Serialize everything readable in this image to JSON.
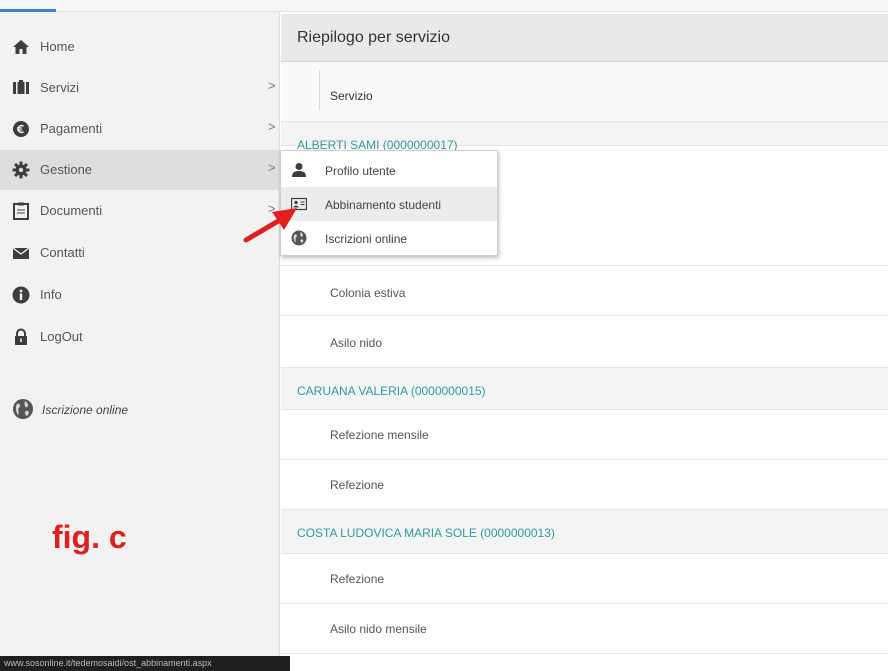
{
  "sidebar": {
    "items": [
      {
        "label": "Home",
        "icon": "home-icon"
      },
      {
        "label": "Servizi",
        "icon": "servizi-icon",
        "chevron": ">"
      },
      {
        "label": "Pagamenti",
        "icon": "pagamenti-icon",
        "chevron": ">"
      },
      {
        "label": "Gestione",
        "icon": "gear-icon",
        "chevron": ">"
      },
      {
        "label": "Documenti",
        "icon": "clipboard-icon",
        "chevron": ">"
      },
      {
        "label": "Contatti",
        "icon": "envelope-icon"
      },
      {
        "label": "Info",
        "icon": "info-icon"
      },
      {
        "label": "LogOut",
        "icon": "lock-icon"
      }
    ],
    "iscrizione": {
      "label": "Iscrizione online",
      "icon": "globe-icon"
    }
  },
  "annotation": {
    "label": "fig. c",
    "color": "#e0201b"
  },
  "statusbar": {
    "url": "www.sosonline.it/tedemosaidi/ost_abbinamenti.aspx"
  },
  "main": {
    "title": "Riepilogo per servizio",
    "column_header": "Servizio",
    "rows": [
      {
        "type": "group",
        "text": "ALBERTI SAMI (0000000017)"
      },
      {
        "type": "item",
        "text": "Colonia estiva"
      },
      {
        "type": "item",
        "text": "Asilo nido"
      },
      {
        "type": "group",
        "text": "CARUANA VALERIA (0000000015)"
      },
      {
        "type": "item",
        "text": "Refezione mensile"
      },
      {
        "type": "item",
        "text": "Refezione"
      },
      {
        "type": "group",
        "text": "COSTA LUDOVICA MARIA SOLE (0000000013)"
      },
      {
        "type": "item",
        "text": "Refezione"
      },
      {
        "type": "item",
        "text": "Asilo nido mensile"
      }
    ]
  },
  "dropdown": {
    "items": [
      {
        "label": "Profilo utente",
        "icon": "user-icon"
      },
      {
        "label": "Abbinamento studenti",
        "icon": "id-card-icon"
      },
      {
        "label": "Iscrizioni online",
        "icon": "globe-icon"
      }
    ]
  },
  "colors": {
    "accent": "#2e9aa3",
    "arrow": "#e0201b"
  }
}
